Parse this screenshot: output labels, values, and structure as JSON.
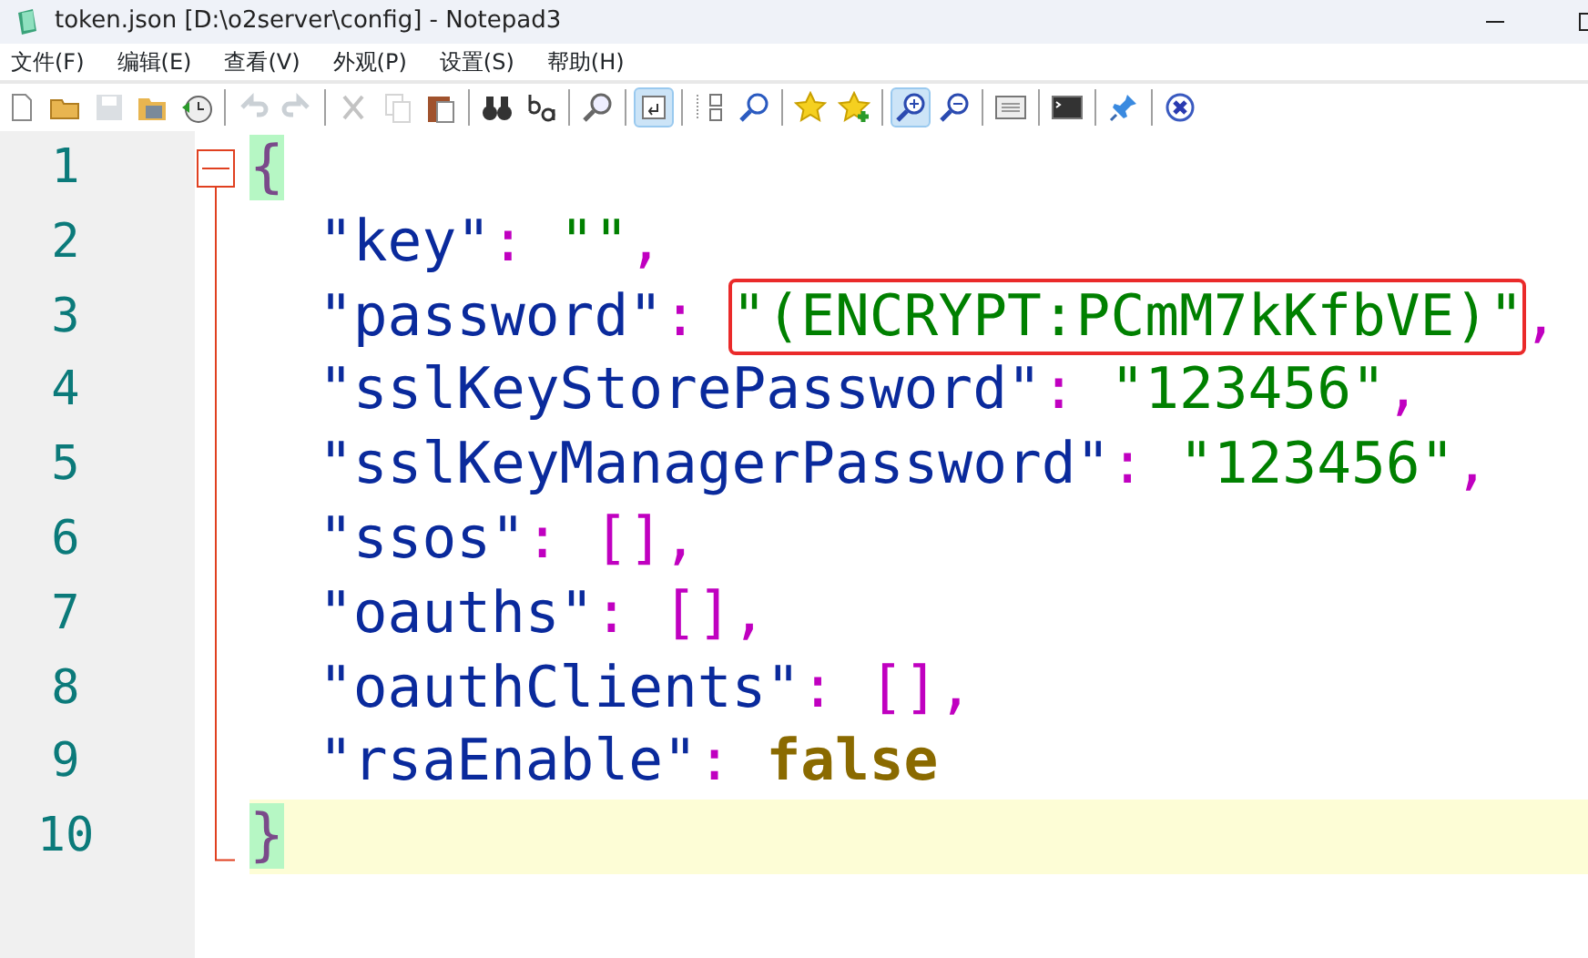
{
  "window": {
    "title": "token.json [D:\\o2server\\config] - Notepad3"
  },
  "menu": [
    "文件(F)",
    "编辑(E)",
    "查看(V)",
    "外观(P)",
    "设置(S)",
    "帮助(H)"
  ],
  "toolbar": [
    [
      {
        "selected": false,
        "disabled": false
      },
      {
        "selected": false,
        "disabled": false
      },
      {
        "selected": false,
        "disabled": true
      },
      {
        "selected": false,
        "disabled": false
      },
      {
        "selected": false,
        "disabled": false
      }
    ],
    [
      {
        "selected": false,
        "disabled": true
      },
      {
        "selected": false,
        "disabled": true
      }
    ],
    [
      {
        "selected": false,
        "disabled": true
      },
      {
        "selected": false,
        "disabled": true
      },
      {
        "selected": false,
        "disabled": false
      }
    ],
    [
      {
        "selected": false,
        "disabled": false
      },
      {
        "selected": false,
        "disabled": false
      }
    ],
    [
      {
        "selected": false,
        "disabled": false
      }
    ],
    [
      {
        "selected": true,
        "disabled": false
      }
    ],
    [
      {
        "selected": false,
        "disabled": false
      },
      {
        "selected": false,
        "disabled": false
      }
    ],
    [
      {
        "selected": false,
        "disabled": false
      },
      {
        "selected": false,
        "disabled": false
      }
    ],
    [
      {
        "selected": true,
        "disabled": false
      },
      {
        "selected": false,
        "disabled": false
      }
    ],
    [
      {
        "selected": false,
        "disabled": false
      }
    ],
    [
      {
        "selected": false,
        "disabled": false
      }
    ],
    [
      {
        "selected": false,
        "disabled": false
      }
    ],
    [
      {
        "selected": false,
        "disabled": false
      }
    ]
  ],
  "editor": {
    "lines": [
      {
        "number": "1",
        "current": false,
        "expanded": true,
        "tokens": [
          {
            "kind": "brace",
            "text": "{",
            "matched": true,
            "boxed": false
          }
        ],
        "children": [
          {
            "number": "2",
            "current": false,
            "tokens": [
              {
                "kind": "key",
                "text": "\"key\"",
                "matched": false,
                "boxed": false
              },
              {
                "kind": "punct",
                "text": ": ",
                "matched": false,
                "boxed": false
              },
              {
                "kind": "string",
                "text": "\"\"",
                "matched": false,
                "boxed": false
              },
              {
                "kind": "punct",
                "text": ",",
                "matched": false,
                "boxed": false
              }
            ]
          },
          {
            "number": "3",
            "current": false,
            "tokens": [
              {
                "kind": "key",
                "text": "\"password\"",
                "matched": false,
                "boxed": false
              },
              {
                "kind": "punct",
                "text": ": ",
                "matched": false,
                "boxed": false
              },
              {
                "kind": "string",
                "text": "\"(ENCRYPT:PCmM7kKfbVE)\"",
                "matched": false,
                "boxed": true
              },
              {
                "kind": "punct",
                "text": ",",
                "matched": false,
                "boxed": false
              }
            ]
          },
          {
            "number": "4",
            "current": false,
            "tokens": [
              {
                "kind": "key",
                "text": "\"sslKeyStorePassword\"",
                "matched": false,
                "boxed": false
              },
              {
                "kind": "punct",
                "text": ": ",
                "matched": false,
                "boxed": false
              },
              {
                "kind": "string",
                "text": "\"123456\"",
                "matched": false,
                "boxed": false
              },
              {
                "kind": "punct",
                "text": ",",
                "matched": false,
                "boxed": false
              }
            ]
          },
          {
            "number": "5",
            "current": false,
            "tokens": [
              {
                "kind": "key",
                "text": "\"sslKeyManagerPassword\"",
                "matched": false,
                "boxed": false
              },
              {
                "kind": "punct",
                "text": ": ",
                "matched": false,
                "boxed": false
              },
              {
                "kind": "string",
                "text": "\"123456\"",
                "matched": false,
                "boxed": false
              },
              {
                "kind": "punct",
                "text": ",",
                "matched": false,
                "boxed": false
              }
            ]
          },
          {
            "number": "6",
            "current": false,
            "tokens": [
              {
                "kind": "key",
                "text": "\"ssos\"",
                "matched": false,
                "boxed": false
              },
              {
                "kind": "punct",
                "text": ": ",
                "matched": false,
                "boxed": false
              },
              {
                "kind": "punct",
                "text": "[],",
                "matched": false,
                "boxed": false
              }
            ]
          },
          {
            "number": "7",
            "current": false,
            "tokens": [
              {
                "kind": "key",
                "text": "\"oauths\"",
                "matched": false,
                "boxed": false
              },
              {
                "kind": "punct",
                "text": ": ",
                "matched": false,
                "boxed": false
              },
              {
                "kind": "punct",
                "text": "[],",
                "matched": false,
                "boxed": false
              }
            ]
          },
          {
            "number": "8",
            "current": false,
            "tokens": [
              {
                "kind": "key",
                "text": "\"oauthClients\"",
                "matched": false,
                "boxed": false
              },
              {
                "kind": "punct",
                "text": ": ",
                "matched": false,
                "boxed": false
              },
              {
                "kind": "punct",
                "text": "[],",
                "matched": false,
                "boxed": false
              }
            ]
          },
          {
            "number": "9",
            "current": false,
            "tokens": [
              {
                "kind": "key",
                "text": "\"rsaEnable\"",
                "matched": false,
                "boxed": false
              },
              {
                "kind": "punct",
                "text": ": ",
                "matched": false,
                "boxed": false
              },
              {
                "kind": "keyword",
                "text": "false",
                "matched": false,
                "boxed": false
              }
            ]
          }
        ]
      },
      {
        "number": "10",
        "current": true,
        "tokens": [
          {
            "kind": "brace",
            "text": "}",
            "matched": true,
            "boxed": false
          }
        ]
      }
    ]
  }
}
